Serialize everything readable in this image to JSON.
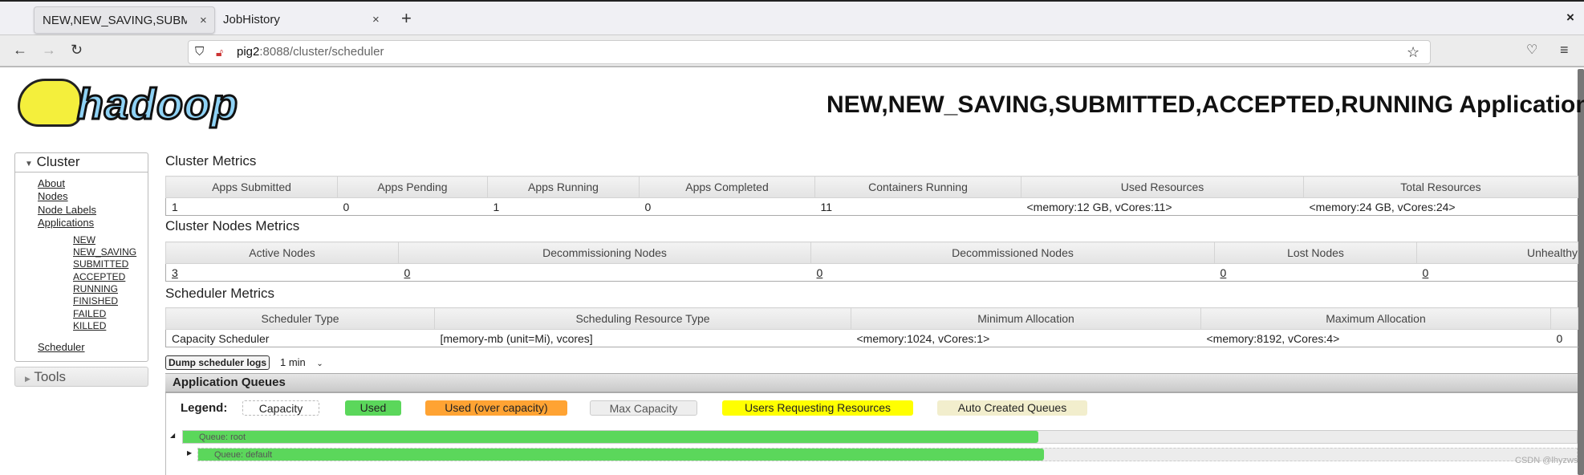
{
  "browser": {
    "tabs": [
      {
        "label": "NEW,NEW_SAVING,SUBMITTED,ACCEPTED,RUNNING Applications",
        "active": true
      },
      {
        "label": "JobHistory",
        "active": false
      }
    ],
    "url_host": "pig2",
    "url_rest": ":8088/cluster/scheduler"
  },
  "page": {
    "logo_text": "hadoop",
    "title": "NEW,NEW_SAVING,SUBMITTED,ACCEPTED,RUNNING Applications"
  },
  "sidebar": {
    "cluster_label": "Cluster",
    "links": [
      "About",
      "Nodes",
      "Node Labels",
      "Applications"
    ],
    "app_states": [
      "NEW",
      "NEW_SAVING",
      "SUBMITTED",
      "ACCEPTED",
      "RUNNING",
      "FINISHED",
      "FAILED",
      "KILLED"
    ],
    "scheduler": "Scheduler",
    "tools_label": "Tools"
  },
  "cluster_metrics": {
    "title": "Cluster Metrics",
    "headers": [
      "Apps Submitted",
      "Apps Pending",
      "Apps Running",
      "Apps Completed",
      "Containers Running",
      "Used Resources",
      "Total Resources"
    ],
    "values": [
      "1",
      "0",
      "1",
      "0",
      "11",
      "<memory:12 GB, vCores:11>",
      "<memory:24 GB, vCores:24>"
    ]
  },
  "nodes_metrics": {
    "title": "Cluster Nodes Metrics",
    "headers": [
      "Active Nodes",
      "Decommissioning Nodes",
      "Decommissioned Nodes",
      "Lost Nodes",
      "Unhealthy"
    ],
    "values": [
      "3",
      "0",
      "0",
      "0",
      "0"
    ]
  },
  "scheduler_metrics": {
    "title": "Scheduler Metrics",
    "headers": [
      "Scheduler Type",
      "Scheduling Resource Type",
      "Minimum Allocation",
      "Maximum Allocation",
      ""
    ],
    "values": [
      "Capacity Scheduler",
      "[memory-mb (unit=Mi), vcores]",
      "<memory:1024, vCores:1>",
      "<memory:8192, vCores:4>",
      "0"
    ]
  },
  "dump": {
    "button": "Dump scheduler logs",
    "interval": "1 min"
  },
  "queues": {
    "title": "Application Queues",
    "legend_label": "Legend:",
    "legend": [
      {
        "label": "Capacity",
        "color": "#ffffff"
      },
      {
        "label": "Used",
        "color": "#5bd75b"
      },
      {
        "label": "Used (over capacity)",
        "color": "#ffa333"
      },
      {
        "label": "Max Capacity",
        "color": "#eeeeee"
      },
      {
        "label": "Users Requesting Resources",
        "color": "#ffff00"
      },
      {
        "label": "Auto Created Queues",
        "color": "#f2eecd"
      }
    ],
    "items": [
      {
        "label": "Queue: root",
        "used_percent": 50
      },
      {
        "label": "Queue: default",
        "used_percent": 50
      }
    ]
  },
  "watermark": "CSDN @lhyzws"
}
